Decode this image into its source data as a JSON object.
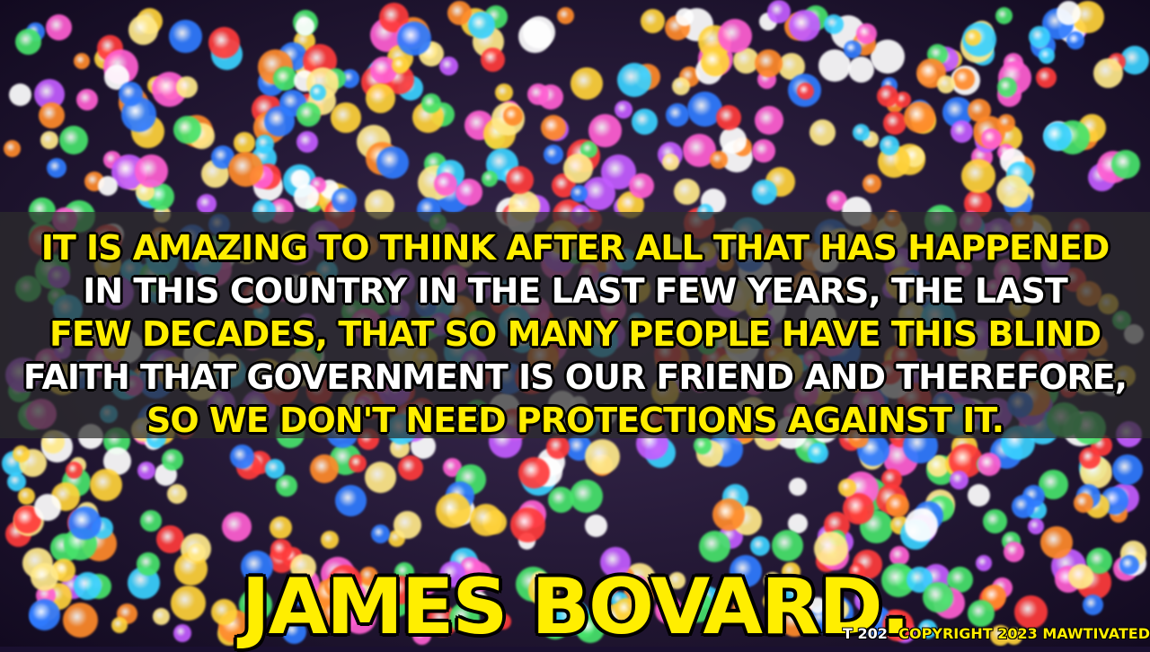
{
  "background": {
    "description_icon": "bokeh-lights-background",
    "palette": [
      "#ff3b3b",
      "#ffd23a",
      "#3ad1ff",
      "#47e36b",
      "#c35cff",
      "#ff8a2a",
      "#ffffff",
      "#2f7bff",
      "#ff5fd2",
      "#ffe98a"
    ]
  },
  "quote": {
    "lines": [
      {
        "text": "IT IS AMAZING TO THINK AFTER ALL THAT HAS HAPPENED",
        "color": "#ffee00"
      },
      {
        "text": "IN THIS COUNTRY IN THE LAST FEW YEARS, THE LAST",
        "color": "#ffffff"
      },
      {
        "text": "FEW DECADES, THAT SO MANY PEOPLE HAVE THIS BLIND",
        "color": "#ffee00"
      },
      {
        "text": "FAITH THAT GOVERNMENT IS OUR FRIEND AND THEREFORE,",
        "color": "#ffffff"
      },
      {
        "text": "SO WE DON'T NEED PROTECTIONS AGAINST IT.",
        "color": "#ffee00"
      }
    ]
  },
  "author": "JAMES BOVARD.",
  "copyright_ghost": "T 202",
  "copyright": "COPYRIGHT 2023 MAWTIVATED"
}
